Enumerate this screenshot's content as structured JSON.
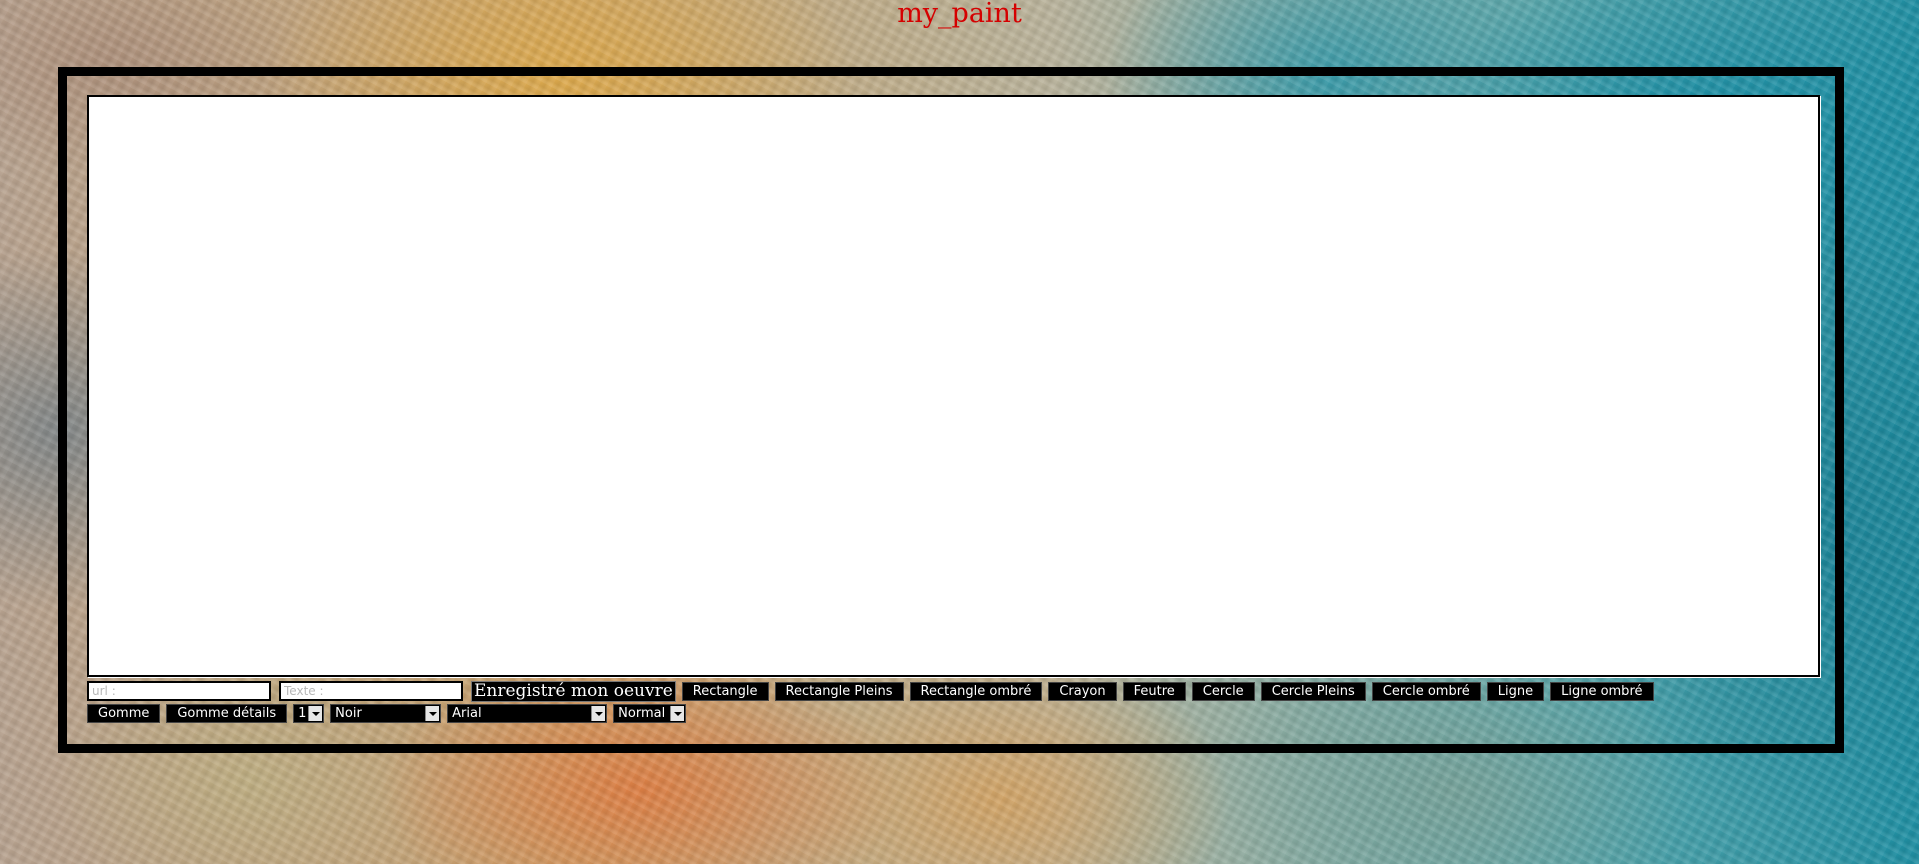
{
  "app": {
    "title": "my_paint"
  },
  "toolbar": {
    "url_placeholder": "url :",
    "text_placeholder": "Texte :",
    "save_label": "Enregistré mon oeuvre",
    "tools": {
      "rectangle": "Rectangle",
      "rectangle_filled": "Rectangle Pleins",
      "rectangle_shadow": "Rectangle ombré",
      "pencil": "Crayon",
      "marker": "Feutre",
      "circle": "Cercle",
      "circle_filled": "Cercle Pleins",
      "circle_shadow": "Cercle ombré",
      "line": "Ligne",
      "line_shadow": "Ligne ombré",
      "eraser": "Gomme",
      "eraser_details": "Gomme détails"
    },
    "selects": {
      "size": "1",
      "color": "Noir",
      "font": "Arial",
      "weight": "Normal"
    }
  },
  "colors": {
    "title": "#d50000",
    "frame": "#000000",
    "canvas": "#ffffff",
    "button_bg": "#000000",
    "button_text": "#ffffff"
  }
}
